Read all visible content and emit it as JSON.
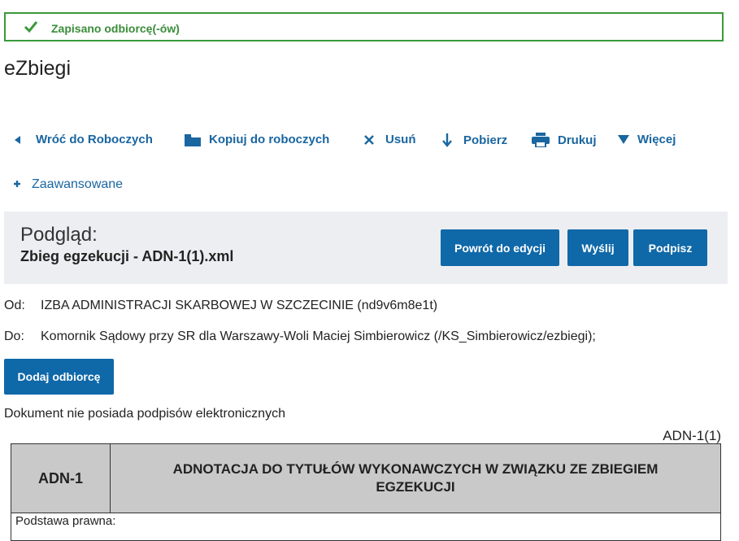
{
  "alert": {
    "message": "Zapisano odbiorcę(-ów)",
    "icon": "check-icon",
    "color": "#3a9a3a"
  },
  "app": {
    "title": "eZbiegi"
  },
  "toolbar": {
    "back": "Wróć do Roboczych",
    "copy": "Kopiuj do roboczych",
    "delete": "Usuń",
    "download": "Pobierz",
    "print": "Drukuj",
    "more": "Więcej",
    "advanced": "Zaawansowane"
  },
  "preview": {
    "title": "Podgląd:",
    "filename": "Zbieg egzekucji - ADN-1(1).xml",
    "buttons": {
      "back_to_edit": "Powrót do edycji",
      "send": "Wyślij",
      "sign": "Podpisz"
    }
  },
  "meta": {
    "from_label": "Od:",
    "from_value": "IZBA ADMINISTRACJI SKARBOWEJ W SZCZECINIE (nd9v6m8e1t)",
    "to_label": "Do:",
    "to_value": "Komornik Sądowy przy SR dla Warszawy-Woli Maciej Simbierowicz (/KS_Simbierowicz/ezbiegi);"
  },
  "add_recipient": "Dodaj odbiorcę",
  "no_signatures": "Dokument nie posiada podpisów elektronicznych",
  "document": {
    "id": "ADN-1(1)",
    "code": "ADN-1",
    "heading": "ADNOTACJA DO TYTUŁÓW WYKONAWCZYCH W ZWIĄZKU ZE ZBIEGIEM EGZEKUCJI",
    "basis_label": "Podstawa prawna:"
  },
  "colors": {
    "accent": "#0f68a8",
    "link": "#1a66a0",
    "panel": "#eceef1",
    "table_header": "#c9c9c9"
  }
}
